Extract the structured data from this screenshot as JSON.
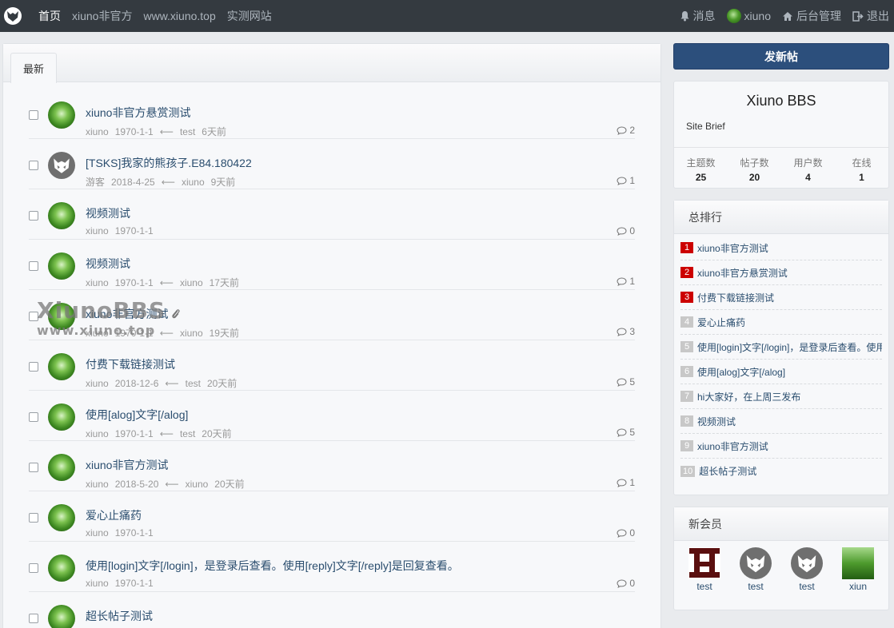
{
  "nav": {
    "links": [
      "首页",
      "xiuno非官方",
      "www.xiuno.top",
      "实测网站"
    ],
    "right": {
      "messages": "消息",
      "user": "xiuno",
      "admin": "后台管理",
      "logout": "退出"
    }
  },
  "main": {
    "tab": "最新",
    "threads": [
      {
        "title": "xiuno非官方悬赏测试",
        "author": "xiuno",
        "date": "1970-1-1",
        "last_user": "test",
        "last_time": "6天前",
        "replies": "2",
        "avatar": "green",
        "attach": false
      },
      {
        "title": "[TSKS]我家的熊孩子.E84.180422",
        "author": "游客",
        "date": "2018-4-25",
        "last_user": "xiuno",
        "last_time": "9天前",
        "replies": "1",
        "avatar": "gray",
        "attach": false
      },
      {
        "title": "视频测试",
        "author": "xiuno",
        "date": "1970-1-1",
        "last_user": "",
        "last_time": "",
        "replies": "0",
        "avatar": "green",
        "attach": false
      },
      {
        "title": "视频测试",
        "author": "xiuno",
        "date": "1970-1-1",
        "last_user": "xiuno",
        "last_time": "17天前",
        "replies": "1",
        "avatar": "green",
        "attach": false
      },
      {
        "title": "xiuno非官方测试",
        "author": "xiuno",
        "date": "1970-1-1",
        "last_user": "xiuno",
        "last_time": "19天前",
        "replies": "3",
        "avatar": "green",
        "attach": true
      },
      {
        "title": "付费下载链接测试",
        "author": "xiuno",
        "date": "2018-12-6",
        "last_user": "test",
        "last_time": "20天前",
        "replies": "5",
        "avatar": "green",
        "attach": false
      },
      {
        "title": "使用[alog]文字[/alog]",
        "author": "xiuno",
        "date": "1970-1-1",
        "last_user": "test",
        "last_time": "20天前",
        "replies": "5",
        "avatar": "green",
        "attach": false
      },
      {
        "title": "xiuno非官方测试",
        "author": "xiuno",
        "date": "2018-5-20",
        "last_user": "xiuno",
        "last_time": "20天前",
        "replies": "1",
        "avatar": "green",
        "attach": false
      },
      {
        "title": "爱心止痛药",
        "author": "xiuno",
        "date": "1970-1-1",
        "last_user": "",
        "last_time": "",
        "replies": "0",
        "avatar": "green",
        "attach": false
      },
      {
        "title": "使用[login]文字[/login]，是登录后查看。使用[reply]文字[/reply]是回复查看。",
        "author": "xiuno",
        "date": "1970-1-1",
        "last_user": "",
        "last_time": "",
        "replies": "0",
        "avatar": "green",
        "attach": false
      },
      {
        "title": "超长帖子测试",
        "author": "",
        "date": "",
        "last_user": "",
        "last_time": "",
        "replies": "",
        "avatar": "green",
        "attach": false
      }
    ],
    "watermark": {
      "line1": "XiunoBBS",
      "line2": "www.xiuno.top"
    }
  },
  "sidebar": {
    "new_post": "发新帖",
    "site": {
      "name": "Xiuno BBS",
      "brief": "Site Brief",
      "stats": [
        {
          "label": "主题数",
          "value": "25"
        },
        {
          "label": "帖子数",
          "value": "20"
        },
        {
          "label": "用户数",
          "value": "4"
        },
        {
          "label": "在线",
          "value": "1"
        }
      ]
    },
    "ranking": {
      "title": "总排行",
      "items": [
        {
          "no": "1",
          "text": "xiuno非官方测试"
        },
        {
          "no": "2",
          "text": "xiuno非官方悬赏测试"
        },
        {
          "no": "3",
          "text": "付费下载链接测试"
        },
        {
          "no": "4",
          "text": "爱心止痛药"
        },
        {
          "no": "5",
          "text": "使用[login]文字[/login]，是登录后查看。使用[reply]文字[/reply]是回复查看。"
        },
        {
          "no": "6",
          "text": "使用[alog]文字[/alog]"
        },
        {
          "no": "7",
          "text": " hi大家好，在上周三发布"
        },
        {
          "no": "8",
          "text": "视频测试"
        },
        {
          "no": "9",
          "text": "xiuno非官方测试"
        },
        {
          "no": "10",
          "text": "超长帖子测试"
        }
      ]
    },
    "members": {
      "title": "新会员",
      "items": [
        {
          "name": "test",
          "avatar": "logo"
        },
        {
          "name": "test",
          "avatar": "gray"
        },
        {
          "name": "test",
          "avatar": "gray"
        },
        {
          "name": "xiun",
          "avatar": "green"
        }
      ]
    }
  },
  "colors": {
    "nav_bg": "#343a40",
    "primary_button": "#2c4f7c",
    "rank_top": "#cc0000",
    "link": "#2a4d6e"
  }
}
